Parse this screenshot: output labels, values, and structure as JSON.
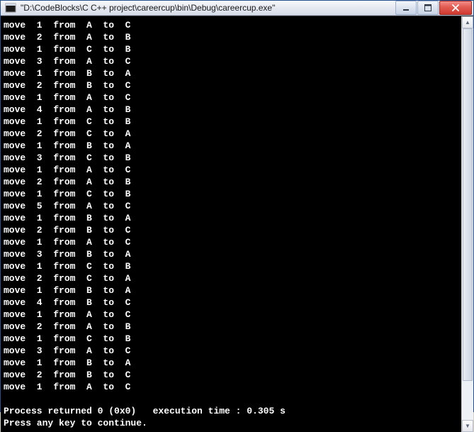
{
  "window": {
    "title": "\"D:\\CodeBlocks\\C C++ project\\careercup\\bin\\Debug\\careercup.exe\""
  },
  "controls": {
    "minimize_tip": "Minimize",
    "maximize_tip": "Maximize",
    "close_tip": "Close"
  },
  "console": {
    "moves": [
      {
        "n": "1",
        "from": "A",
        "to": "C"
      },
      {
        "n": "2",
        "from": "A",
        "to": "B"
      },
      {
        "n": "1",
        "from": "C",
        "to": "B"
      },
      {
        "n": "3",
        "from": "A",
        "to": "C"
      },
      {
        "n": "1",
        "from": "B",
        "to": "A"
      },
      {
        "n": "2",
        "from": "B",
        "to": "C"
      },
      {
        "n": "1",
        "from": "A",
        "to": "C"
      },
      {
        "n": "4",
        "from": "A",
        "to": "B"
      },
      {
        "n": "1",
        "from": "C",
        "to": "B"
      },
      {
        "n": "2",
        "from": "C",
        "to": "A"
      },
      {
        "n": "1",
        "from": "B",
        "to": "A"
      },
      {
        "n": "3",
        "from": "C",
        "to": "B"
      },
      {
        "n": "1",
        "from": "A",
        "to": "C"
      },
      {
        "n": "2",
        "from": "A",
        "to": "B"
      },
      {
        "n": "1",
        "from": "C",
        "to": "B"
      },
      {
        "n": "5",
        "from": "A",
        "to": "C"
      },
      {
        "n": "1",
        "from": "B",
        "to": "A"
      },
      {
        "n": "2",
        "from": "B",
        "to": "C"
      },
      {
        "n": "1",
        "from": "A",
        "to": "C"
      },
      {
        "n": "3",
        "from": "B",
        "to": "A"
      },
      {
        "n": "1",
        "from": "C",
        "to": "B"
      },
      {
        "n": "2",
        "from": "C",
        "to": "A"
      },
      {
        "n": "1",
        "from": "B",
        "to": "A"
      },
      {
        "n": "4",
        "from": "B",
        "to": "C"
      },
      {
        "n": "1",
        "from": "A",
        "to": "C"
      },
      {
        "n": "2",
        "from": "A",
        "to": "B"
      },
      {
        "n": "1",
        "from": "C",
        "to": "B"
      },
      {
        "n": "3",
        "from": "A",
        "to": "C"
      },
      {
        "n": "1",
        "from": "B",
        "to": "A"
      },
      {
        "n": "2",
        "from": "B",
        "to": "C"
      },
      {
        "n": "1",
        "from": "A",
        "to": "C"
      }
    ],
    "move_word": "move",
    "from_word": "from",
    "to_word": "to",
    "blank": "",
    "return_line": "Process returned 0 (0x0)   execution time : 0.305 s",
    "press_line": "Press any key to continue."
  }
}
